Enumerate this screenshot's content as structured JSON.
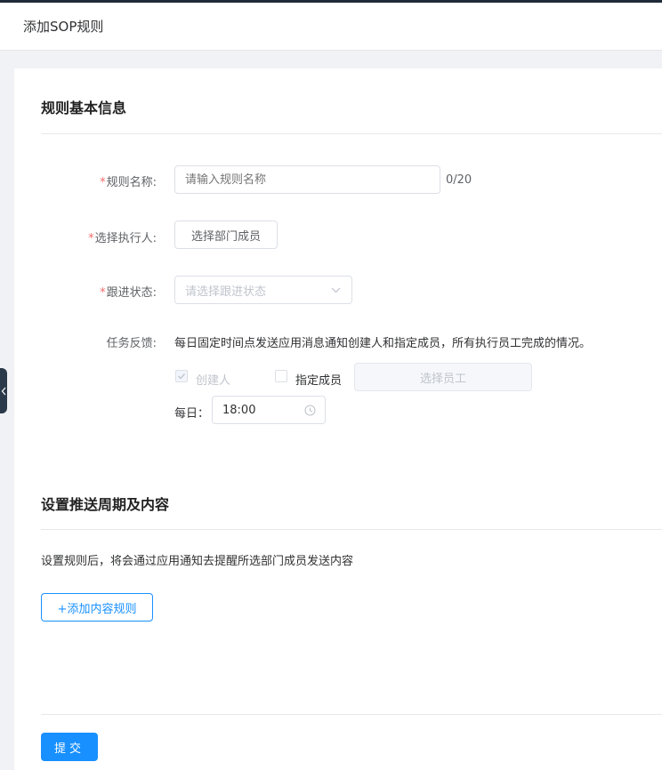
{
  "header": {
    "title": "添加SOP规则"
  },
  "basic": {
    "section_title": "规则基本信息",
    "name": {
      "label": "规则名称:",
      "placeholder": "请输入规则名称",
      "counter": "0/20"
    },
    "executor": {
      "label": "选择执行人:",
      "button": "选择部门成员"
    },
    "status": {
      "label": "跟进状态:",
      "placeholder": "请选择跟进状态"
    },
    "feedback": {
      "label": "任务反馈:",
      "description": "每日固定时间点发送应用消息通知创建人和指定成员，所有执行员工完成的情况。",
      "creator_checkbox": "创建人",
      "member_checkbox": "指定成员",
      "select_staff_button": "选择员工",
      "daily_label": "每日：",
      "time_value": "18:00"
    }
  },
  "push": {
    "section_title": "设置推送周期及内容",
    "hint": "设置规则后，将会通过应用通知去提醒所选部门成员发送内容",
    "add_rule_button": "+添加内容规则"
  },
  "footer": {
    "submit_button": "提交"
  },
  "colors": {
    "primary": "#1890ff",
    "required": "#f56c6c",
    "sidebar": "#2b3a4a"
  }
}
